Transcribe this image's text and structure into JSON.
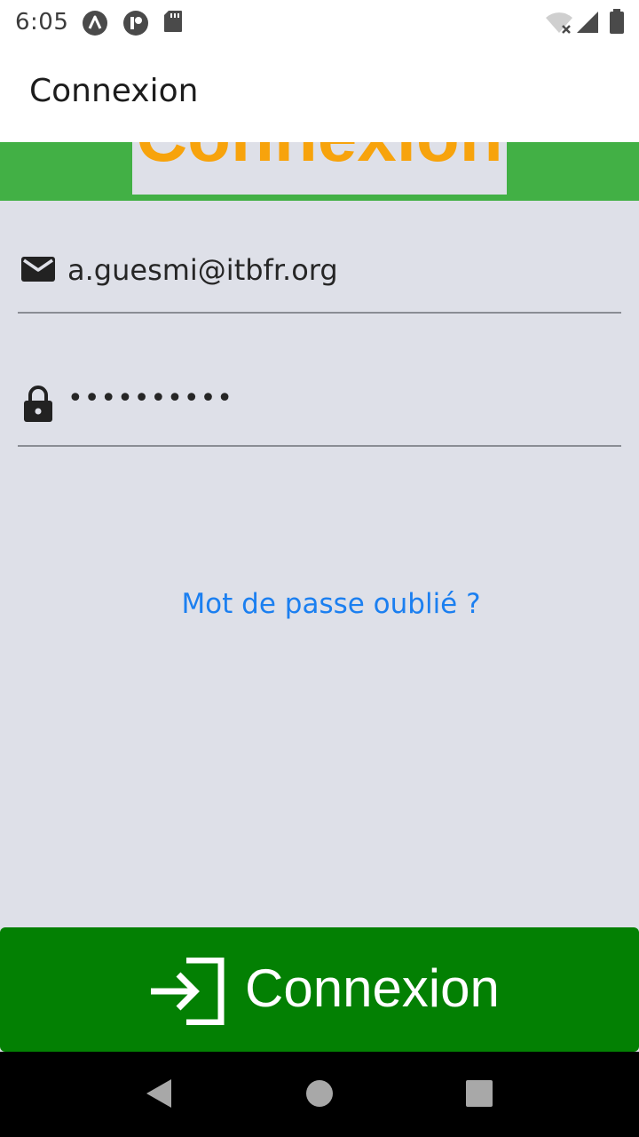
{
  "status_bar": {
    "time": "6:05",
    "left_icons": [
      "accessibility-a-icon",
      "app-p-icon",
      "sd-card-icon"
    ],
    "right_icons": [
      "wifi-off-icon",
      "cell-signal-icon",
      "battery-icon"
    ]
  },
  "app_bar": {
    "title": "Connexion"
  },
  "header": {
    "title": "Connexion",
    "colors": {
      "band": "#42b045",
      "title": "#f7a30c"
    }
  },
  "form": {
    "email": {
      "icon": "mail-icon",
      "value": "a.guesmi@itbfr.org"
    },
    "password": {
      "icon": "lock-icon",
      "value": "••••••••••"
    },
    "forgot_password": "Mot de passe oublié ?"
  },
  "login_button": {
    "label": "Connexion",
    "icon": "login-arrow-icon",
    "color": "#038003"
  },
  "nav_bar": {
    "buttons": [
      "back-icon",
      "home-icon",
      "recents-icon"
    ]
  }
}
